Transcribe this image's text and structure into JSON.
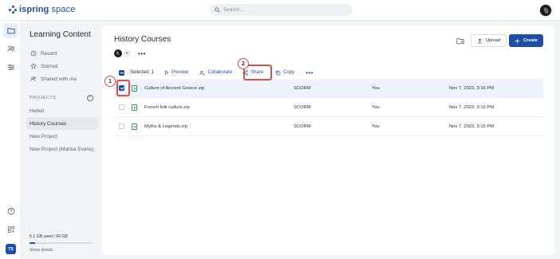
{
  "app": {
    "logo_prefix": "ispring",
    "logo_suffix": "space",
    "search_placeholder": "Search..."
  },
  "rail": {
    "items": [
      {
        "name": "content-folder-icon",
        "active": true
      },
      {
        "name": "users-icon",
        "active": false
      },
      {
        "name": "settings-sliders-icon",
        "active": false
      },
      {
        "name": "help-icon",
        "active": false
      },
      {
        "name": "apps-icon",
        "active": false
      }
    ],
    "user_initials": "TS"
  },
  "sidebar": {
    "title": "Learning Content",
    "nav": [
      {
        "label": "Recent",
        "icon": "clock-icon"
      },
      {
        "label": "Starred",
        "icon": "star-icon"
      },
      {
        "label": "Shared with me",
        "icon": "shared-users-icon"
      }
    ],
    "projects_heading": "PROJECTS",
    "projects": [
      {
        "label": "Hellen",
        "active": false
      },
      {
        "label": "History Courses",
        "active": true
      },
      {
        "label": "New Project",
        "active": false
      },
      {
        "label": "New Project (Marisa Evans)",
        "active": false
      }
    ],
    "storage_text": "5.1 GB used / 60 GB",
    "storage_used_fraction": 0.085,
    "show_details": "Show details"
  },
  "main": {
    "title": "History Courses",
    "owner_more": "•••",
    "upload_label": "Upload",
    "create_label": "Create",
    "toolbar": {
      "selected_text": "Selected: 1",
      "preview": "Preview",
      "collaborate": "Collaborate",
      "share": "Share",
      "copy": "Copy",
      "more": "•••"
    },
    "rows": [
      {
        "name": "Culture of Ancient Greece.zip",
        "type": "SCORM",
        "owner": "You",
        "date": "Nov 7, 2023, 3:16 PM",
        "selected": true
      },
      {
        "name": "French folk culture.zip",
        "type": "SCORM",
        "owner": "You",
        "date": "Nov 7, 2023, 3:15 PM",
        "selected": false
      },
      {
        "name": "Myths & Legends.zip",
        "type": "SCORM",
        "owner": "You",
        "date": "Nov 7, 2023, 3:15 PM",
        "selected": false
      }
    ]
  },
  "annotations": {
    "step1": "1",
    "step2": "2"
  },
  "colors": {
    "accent": "#1d4fa8",
    "annotation": "#d84e4b",
    "file_icon": "#2e9b5c"
  }
}
